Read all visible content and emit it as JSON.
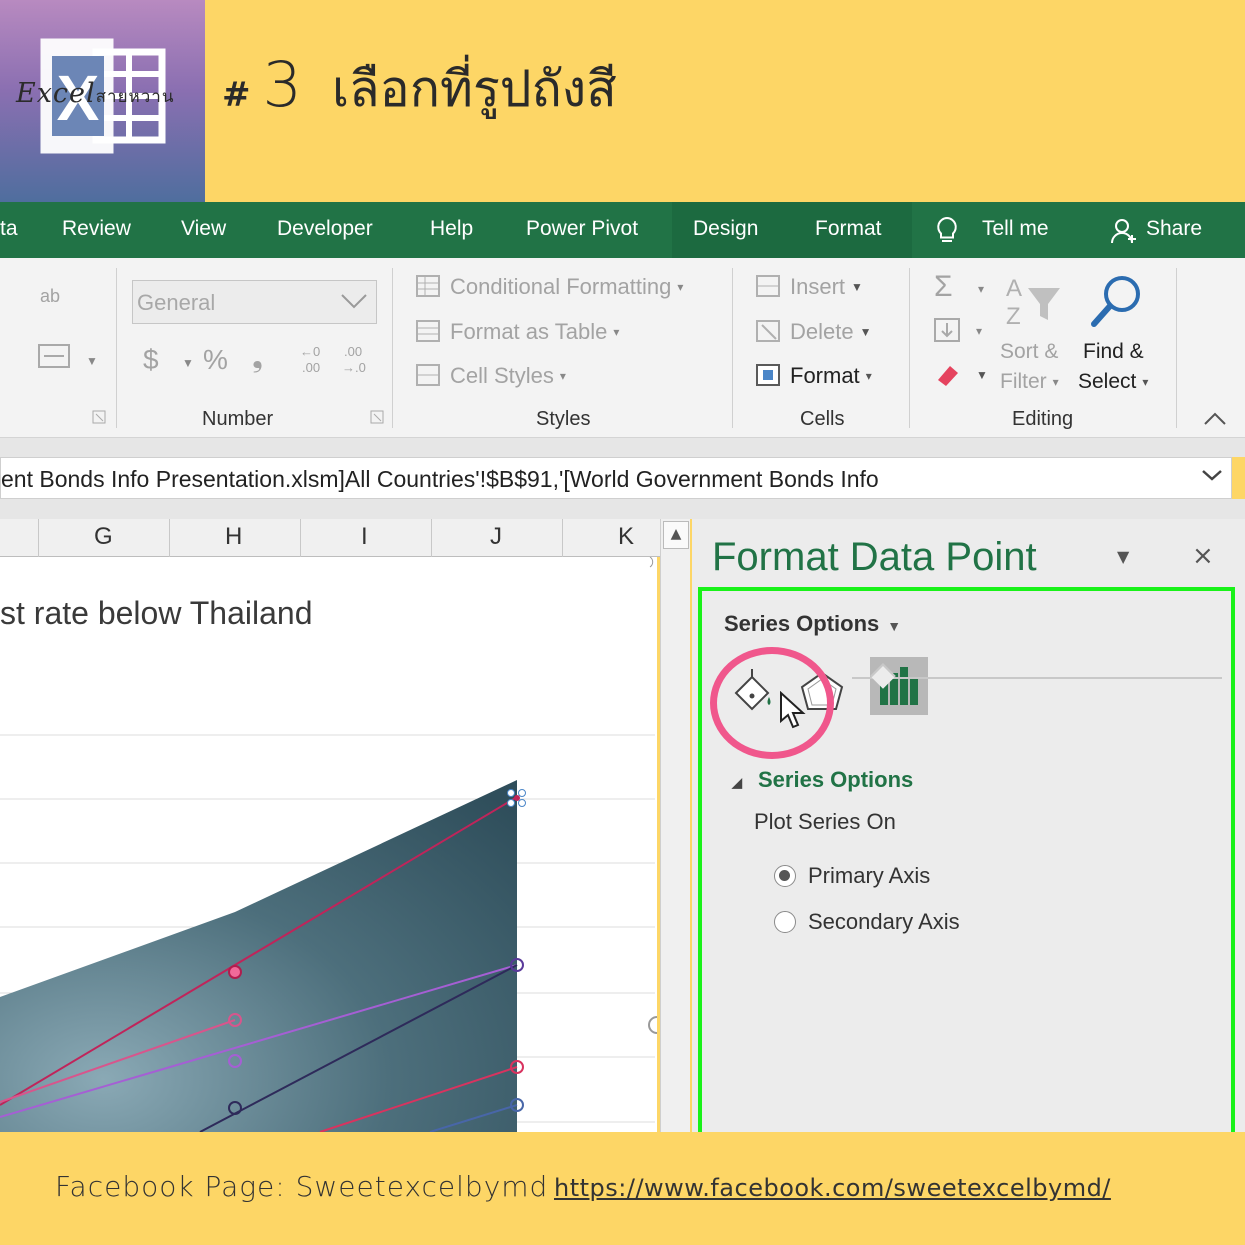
{
  "header": {
    "logo_text": "Excel",
    "logo_text_small": "สายหวาน",
    "step_hash": "#",
    "step_number": "3",
    "step_text": "เลือกที่รูปถังสี"
  },
  "ribbon_tabs": [
    "ta",
    "Review",
    "View",
    "Developer",
    "Help",
    "Power Pivot",
    "Design",
    "Format",
    "Tell me",
    "Share"
  ],
  "ribbon": {
    "number_format_value": "General",
    "currency_symbol": "$",
    "percent_symbol": "%",
    "comma_symbol": "❟",
    "styles": {
      "conditional_formatting": "Conditional Formatting",
      "format_as_table": "Format as Table",
      "cell_styles": "Cell Styles"
    },
    "cells": {
      "insert": "Insert",
      "delete": "Delete",
      "format": "Format"
    },
    "editing": {
      "sort_filter_1": "Sort &",
      "sort_filter_2": "Filter",
      "find_select_1": "Find &",
      "find_select_2": "Select"
    },
    "group_labels": {
      "number": "Number",
      "styles": "Styles",
      "cells": "Cells",
      "editing": "Editing"
    }
  },
  "formula_bar": {
    "text": "ent Bonds Info Presentation.xlsm]All Countries'!$B$91,'[World Government Bonds Info"
  },
  "sheet": {
    "columns": [
      "G",
      "H",
      "I",
      "J",
      "K"
    ],
    "chart_title": "st rate below Thailand"
  },
  "pane": {
    "title": "Format Data Point",
    "close": "×",
    "options_header": "Series Options",
    "section_header": "Series Options",
    "plot_series_on": "Plot Series On",
    "radio_primary": "Primary Axis",
    "radio_secondary": "Secondary Axis",
    "selected": "Primary Axis",
    "highlight_color": "#f0578c",
    "frame_color": "#19f219"
  },
  "footer": {
    "label": "Facebook Page: Sweetexcelbymd",
    "link": "https://www.facebook.com/sweetexcelbymd/"
  },
  "colors": {
    "excel_green": "#217346",
    "background_yellow": "#fdd666"
  }
}
